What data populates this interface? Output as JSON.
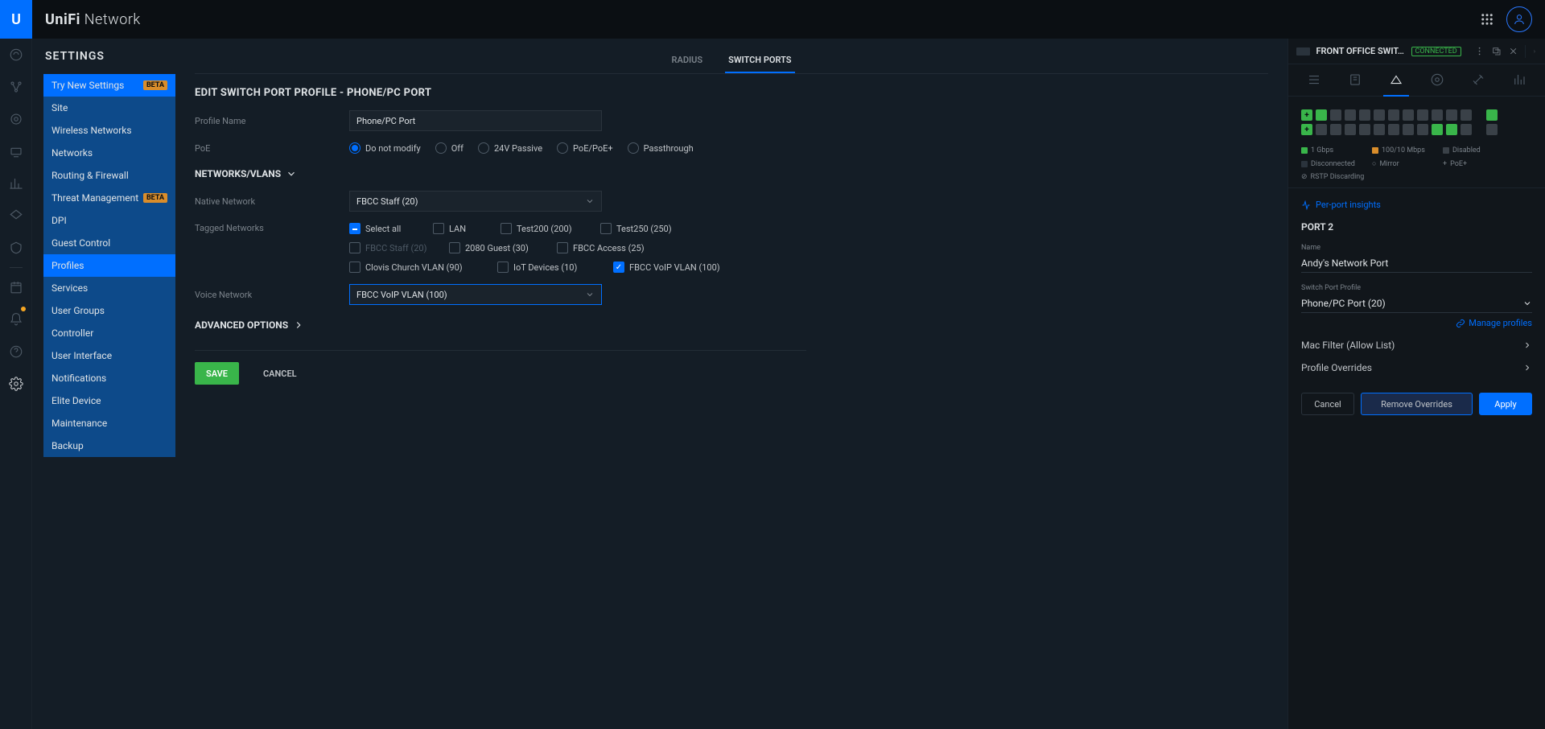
{
  "brand_prefix": "UniFi",
  "brand_suffix": "Network",
  "settings_title": "SETTINGS",
  "nav": {
    "try_new": "Try New Settings",
    "site": "Site",
    "wireless": "Wireless Networks",
    "networks": "Networks",
    "routing": "Routing & Firewall",
    "threat": "Threat Management",
    "dpi": "DPI",
    "guest": "Guest Control",
    "profiles": "Profiles",
    "services": "Services",
    "usergroups": "User Groups",
    "controller": "Controller",
    "ui": "User Interface",
    "notifications": "Notifications",
    "elite": "Elite Device",
    "maintenance": "Maintenance",
    "backup": "Backup",
    "badge_beta": "BETA"
  },
  "tabs": {
    "radius": "RADIUS",
    "switch_ports": "SWITCH PORTS"
  },
  "form": {
    "heading": "EDIT SWITCH PORT PROFILE - PHONE/PC PORT",
    "profile_name_label": "Profile Name",
    "profile_name_value": "Phone/PC Port",
    "poe_label": "PoE",
    "poe_opts": {
      "do_not_modify": "Do not modify",
      "off": "Off",
      "24v": "24V Passive",
      "poe_plus": "PoE/PoE+",
      "passthrough": "Passthrough"
    },
    "networks_vlans": "NETWORKS/VLANS",
    "native_label": "Native Network",
    "native_value": "FBCC Staff (20)",
    "tagged_label": "Tagged Networks",
    "tagged": {
      "select_all": "Select all",
      "lan": "LAN",
      "test200": "Test200 (200)",
      "test250": "Test250 (250)",
      "fbcc_staff": "FBCC Staff (20)",
      "guest_2080": "2080 Guest (30)",
      "fbcc_access": "FBCC Access (25)",
      "clovis": "Clovis Church VLAN (90)",
      "iot": "IoT Devices (10)",
      "voip": "FBCC VoIP VLAN (100)"
    },
    "voice_label": "Voice Network",
    "voice_value": "FBCC VoIP VLAN (100)",
    "advanced": "ADVANCED OPTIONS",
    "save": "SAVE",
    "cancel": "CANCEL"
  },
  "panel": {
    "device_name": "FRONT OFFICE SWIT...",
    "status": "CONNECTED",
    "legend": {
      "gbps": "1 Gbps",
      "10010": "100/10 Mbps",
      "disabled": "Disabled",
      "disconnected": "Disconnected",
      "mirror": "Mirror",
      "poe": "PoE+",
      "rstp": "RSTP Discarding"
    },
    "insights": "Per-port insights",
    "port_heading": "PORT 2",
    "name_label": "Name",
    "name_value": "Andy's Network Port",
    "profile_label": "Switch Port Profile",
    "profile_value": "Phone/PC Port (20)",
    "manage_profiles": "Manage profiles",
    "mac_filter": "Mac Filter (Allow List)",
    "overrides": "Profile Overrides",
    "cancel": "Cancel",
    "remove": "Remove Overrides",
    "apply": "Apply"
  }
}
